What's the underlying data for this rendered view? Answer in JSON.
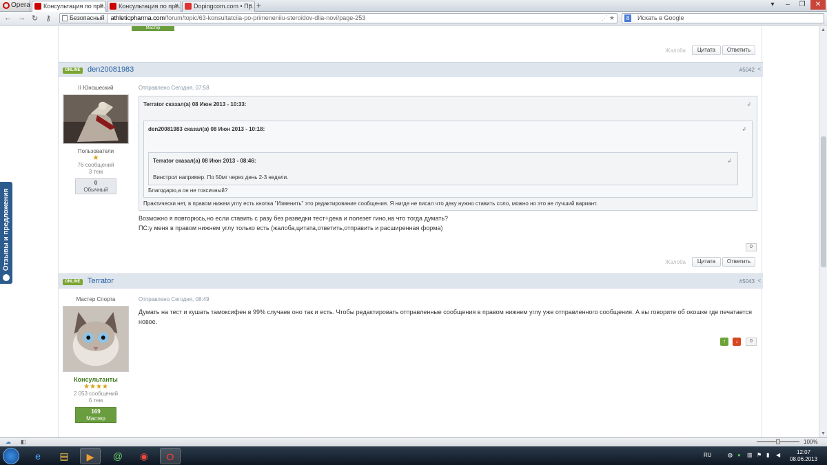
{
  "browser": {
    "menu_label": "Opera",
    "tabs": [
      {
        "title": "Консультация по при..."
      },
      {
        "title": "Консультация по при..."
      },
      {
        "title": "Dopingcom.com • Пр..."
      }
    ],
    "new_tab": "+",
    "secure_label": "Безопасный",
    "url_host": "athleticpharma.com",
    "url_path": "/forum/topic/63-konsultatciia-po-primeneniiu-steroidov-dlia-novi/page-253",
    "search_placeholder": "Искать в Google"
  },
  "feedback_tab": "Отзывы и предложения",
  "top_fragment": {
    "badge": "Мастер",
    "report": "Жалоба",
    "quote": "Цитата",
    "reply": "Ответить"
  },
  "posts": [
    {
      "status": "ONLINE",
      "username": "den20081983",
      "post_number": "#5042",
      "rank": "II Юношеский",
      "group": "Пользователи",
      "stars": "★",
      "messages": "76 сообщений",
      "topics": "3 тем",
      "rep_value": "0",
      "rep_label": "Обычный",
      "posted": "Отправлено Сегодня, 07:58",
      "quote1_header": "Terrator сказал(а) 08 Июн 2013 - 10:33:",
      "quote2_header": "den20081983 сказал(а) 08 Июн 2013 - 10:18:",
      "quote3_header": "Terrator сказал(а) 08 Июн 2013 - 08:46:",
      "quote3_text": "Винстрол например. По 50мг через день 2-3 недели.",
      "quote2_text": "Благодарю,а он не токсичный?",
      "quote1_text": "Практически нет, в правом нижем углу есть кнопка \"Изменить\" это редактирование сообщения. Я нигде не писал что деку нужно ставить соло, можно но это не лучший вариант.",
      "body_line1": "Возможно я повторюсь,но если ставить с разу без разведки тест+дека и полезет гино,на что тогда думать?",
      "body_line2": "ПС:у меня в правом нижнем углу только есть (жалоба,цитата,ответить,отправить и расширенная форма)",
      "vote_count": "0",
      "report": "Жалоба",
      "quote": "Цитата",
      "reply": "Ответить"
    },
    {
      "status": "ONLINE",
      "username": "Terrator",
      "post_number": "#5043",
      "rank": "Мастер Спорта",
      "group": "Консультанты",
      "stars": "★★★★",
      "messages": "2 053 сообщений",
      "topics": "6 тем",
      "rep_value": "169",
      "rep_label": "Мастер",
      "posted": "Отправлено Сегодня, 08:49",
      "body_line1": "Думать на тест и кушать тамоксифен в 99% случаев оно так и есть. Чтобы редактировать отправленные сообщения в правом нижнем углу уже отправленного сообщения. А вы говорите об окошке где печатается",
      "body_line2": "новое.",
      "vote_count": "0"
    }
  ],
  "status_bar": {
    "zoom": "100%"
  },
  "taskbar": {
    "lang": "RU",
    "time": "12:07",
    "date": "08.06.2013"
  },
  "colors": {
    "online": "#7ba531",
    "link": "#245fa3",
    "rep_master": "#6a9d3d",
    "header_bg": "#dfe5ed"
  }
}
